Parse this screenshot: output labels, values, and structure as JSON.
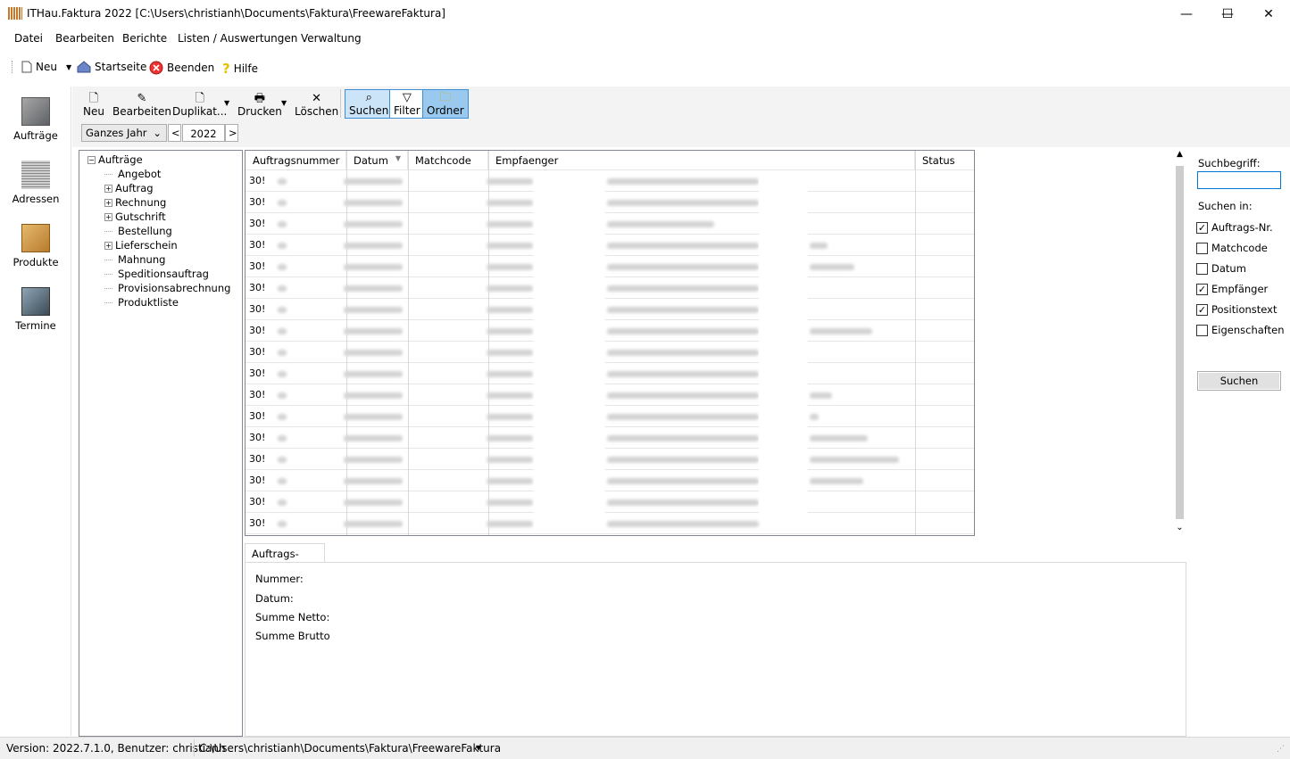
{
  "window": {
    "title": "ITHau.Faktura 2022 [C:\\Users\\christianh\\Documents\\Faktura\\FreewareFaktura]",
    "minimize": "—",
    "maximize": "☐",
    "close": "✕"
  },
  "menu": [
    "Datei",
    "Bearbeiten",
    "Berichte",
    "Listen / Auswertungen",
    "Verwaltung"
  ],
  "toolbar": {
    "new": "Neu",
    "home": "Startseite",
    "exit": "Beenden",
    "help": "Hilfe"
  },
  "leftnav": [
    "Aufträge",
    "Adressen",
    "Produkte",
    "Termine"
  ],
  "worktoolbar": {
    "new": "Neu",
    "edit": "Bearbeiten",
    "duplicate": "Duplikat...",
    "print": "Drucken",
    "delete": "Löschen",
    "search": "Suchen",
    "filter": "Filter",
    "folder": "Ordner"
  },
  "period": {
    "range": "Ganzes Jahr",
    "year": "2022",
    "prev": "<",
    "next": ">"
  },
  "tree": {
    "root": "Aufträge",
    "children": [
      {
        "label": "Angebot",
        "expandable": false
      },
      {
        "label": "Auftrag",
        "expandable": true
      },
      {
        "label": "Rechnung",
        "expandable": true
      },
      {
        "label": "Gutschrift",
        "expandable": true
      },
      {
        "label": "Bestellung",
        "expandable": false
      },
      {
        "label": "Lieferschein",
        "expandable": true
      },
      {
        "label": "Mahnung",
        "expandable": false
      },
      {
        "label": "Speditionsauftrag",
        "expandable": false
      },
      {
        "label": "Provisionsabrechnung",
        "expandable": false
      },
      {
        "label": "Produktliste",
        "expandable": false
      }
    ]
  },
  "grid": {
    "columns": [
      "Auftragsnummer",
      "Datum",
      "Matchcode",
      "Empfaenger",
      "Status"
    ],
    "row_prefix": [
      "30!",
      "30!",
      "30!",
      "30!",
      "30!",
      "30!",
      "30!",
      "30!",
      "30!",
      "30!",
      "30!",
      "30!",
      "30!",
      "30!",
      "30!",
      "30!",
      "30!"
    ]
  },
  "search": {
    "label": "Suchbegriff:",
    "value": "",
    "in_label": "Suchen in:",
    "options": [
      {
        "label": "Auftrags-Nr.",
        "checked": true
      },
      {
        "label": "Matchcode",
        "checked": false
      },
      {
        "label": "Datum",
        "checked": false
      },
      {
        "label": "Empfänger",
        "checked": true
      },
      {
        "label": "Positionstext",
        "checked": true
      },
      {
        "label": "Eigenschaften",
        "checked": false
      }
    ],
    "button": "Suchen"
  },
  "details": {
    "tab": "Auftrags-Details",
    "labels": [
      "Nummer:",
      "Datum:",
      "Summe Netto:",
      "Summe Brutto"
    ]
  },
  "status": {
    "version": "Version: 2022.7.1.0, Benutzer: christianh",
    "path": "C:\\Users\\christianh\\Documents\\Faktura\\FreewareFaktura"
  }
}
